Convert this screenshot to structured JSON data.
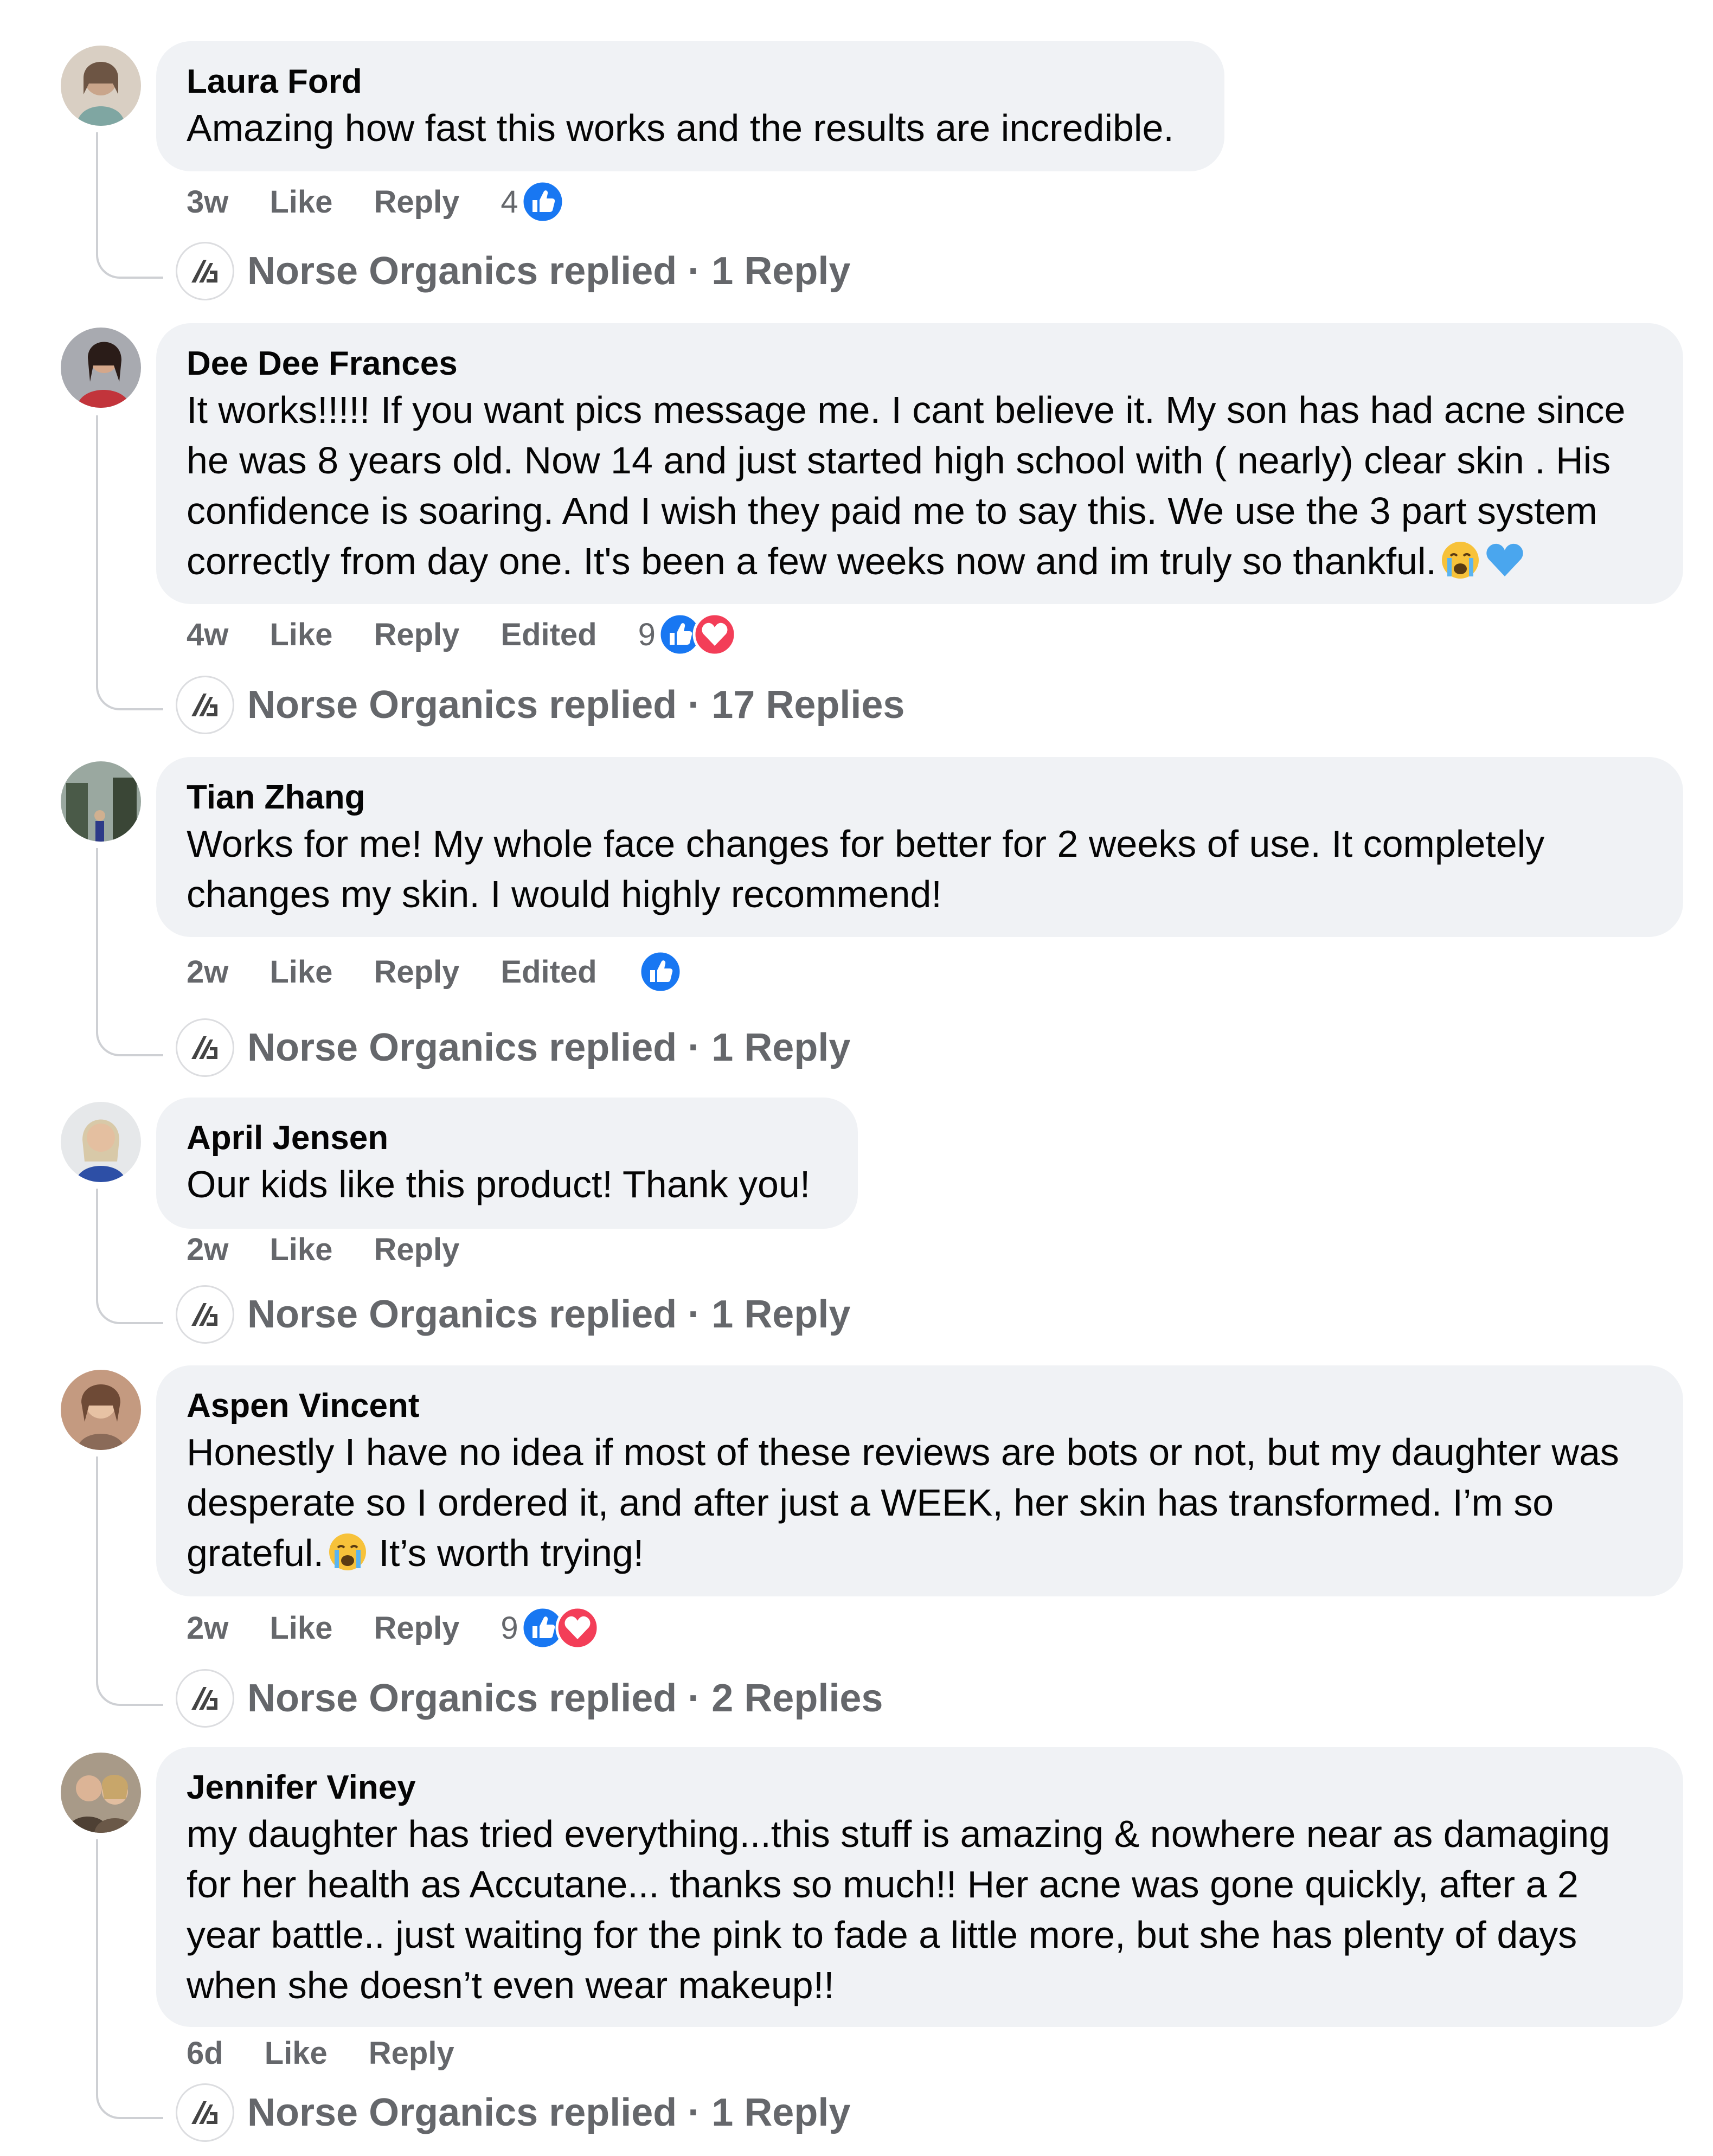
{
  "comments": [
    {
      "author": "Laura Ford",
      "text": "Amazing how fast this works and the results are incredible.",
      "time": "3w",
      "like_label": "Like",
      "reply_label": "Reply",
      "edited_label": "",
      "reaction_count": "4",
      "reactions": [
        "like-icon"
      ],
      "replied_label": "Norse Organics replied · 1 Reply",
      "avatar_colors": [
        "#b8a795",
        "#6d5544"
      ]
    },
    {
      "author": "Dee Dee Frances",
      "text": "It works!!!!! If you want pics message me. I cant believe it. My son has had acne since he was 8 years old. Now 14 and just started high school with ( nearly) clear skin . His confidence is soaring. And I wish they paid me to say this. We use the 3 part system correctly from day one. It's been a few weeks now and im truly so thankful.",
      "time": "4w",
      "like_label": "Like",
      "reply_label": "Reply",
      "edited_label": "Edited",
      "reaction_count": "9",
      "reactions": [
        "like-icon",
        "heart-icon"
      ],
      "replied_label": "Norse Organics replied · 17 Replies",
      "avatar_colors": [
        "#a8aab0",
        "#c2343b"
      ]
    },
    {
      "author": "Tian Zhang",
      "text": "Works for me! My whole face changes for better for 2 weeks of use. It completely changes my skin. I would highly recommend!",
      "time": "2w",
      "like_label": "Like",
      "reply_label": "Reply",
      "edited_label": "Edited",
      "reaction_count": "",
      "reactions": [
        "like-icon"
      ],
      "replied_label": "Norse Organics replied · 1 Reply",
      "avatar_colors": [
        "#5a6a4e",
        "#2f3a34"
      ]
    },
    {
      "author": "April Jensen",
      "text": "Our kids like this product! Thank you!",
      "time": "2w",
      "like_label": "Like",
      "reply_label": "Reply",
      "edited_label": "",
      "reaction_count": "",
      "reactions": [],
      "replied_label": "Norse Organics replied · 1 Reply",
      "avatar_colors": [
        "#d8c9a8",
        "#2d4fa6"
      ]
    },
    {
      "author": "Aspen Vincent",
      "text": "Honestly I have no idea if most of these reviews are bots or not, but my daughter was desperate so I ordered it, and after just a WEEK, her skin has transformed. I’m so grateful.",
      "text_after_emoji": " It’s worth trying!",
      "time": "2w",
      "like_label": "Like",
      "reply_label": "Reply",
      "edited_label": "",
      "reaction_count": "9",
      "reactions": [
        "like-icon",
        "heart-icon"
      ],
      "replied_label": "Norse Organics replied · 2 Replies",
      "avatar_colors": [
        "#c49a80",
        "#6e4a36"
      ]
    },
    {
      "author": "Jennifer Viney",
      "text": "my daughter has tried everything...this stuff is amazing & nowhere near as damaging for her health as Accutane... thanks so much!! Her acne was gone quickly, after a 2 year battle.. just waiting for the pink to fade a little more, but she has plenty of days when she doesn’t even wear makeup!!",
      "time": "6d",
      "like_label": "Like",
      "reply_label": "Reply",
      "edited_label": "",
      "reaction_count": "",
      "reactions": [],
      "replied_label": "Norse Organics replied · 1 Reply",
      "avatar_colors": [
        "#a89a88",
        "#4e4034"
      ]
    }
  ],
  "colors": {
    "bubble": "#f0f2f5",
    "meta_text": "#65676b",
    "like_blue": "#1877f2",
    "heart_red": "#f33e58"
  }
}
